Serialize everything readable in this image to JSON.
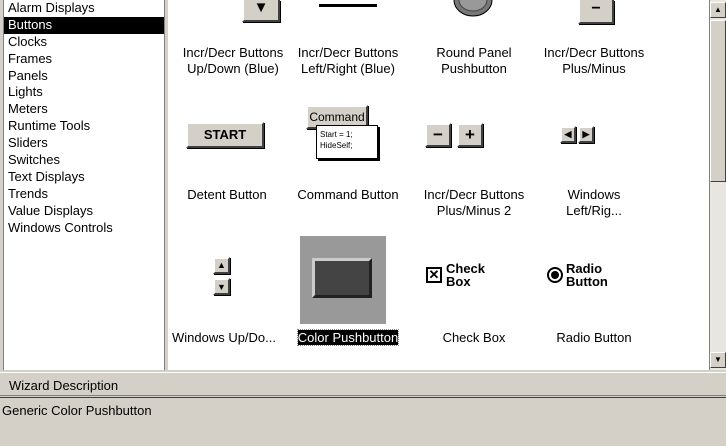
{
  "categories": [
    "Alarm Displays",
    "Buttons",
    "Clocks",
    "Frames",
    "Panels",
    "Lights",
    "Meters",
    "Runtime Tools",
    "Sliders",
    "Switches",
    "Text Displays",
    "Trends",
    "Value Displays",
    "Windows Controls"
  ],
  "selected_category": "Buttons",
  "wizards": {
    "r0": [
      "Incr/Decr Buttons Up/Down (Blue)",
      "Incr/Decr Buttons Left/Right (Blue)",
      "Round Panel Pushbutton",
      "Incr/Decr Buttons Plus/Minus"
    ],
    "start": "START",
    "command": "Command",
    "command_script": "Start = 1;\nHideSelf;",
    "detent": "Detent Button",
    "command_button": "Command Button",
    "pm2": "Incr/Decr Buttons Plus/Minus 2",
    "win_lr": "Windows Left/Rig...",
    "win_ud": "Windows Up/Do...",
    "color_pb": "Color Pushbutton",
    "checkbox": "Check Box",
    "checkbox_icon": "Check Box",
    "radio": "Radio Button",
    "radio_icon": "Radio Button",
    "minus_glyph": "−",
    "plus_glyph": "+"
  },
  "description_header": "Wizard Description",
  "description_text": "Generic Color Pushbutton",
  "icons": {
    "scroll_up": "scroll-up-arrow-icon",
    "scroll_down": "scroll-down-arrow-icon"
  }
}
